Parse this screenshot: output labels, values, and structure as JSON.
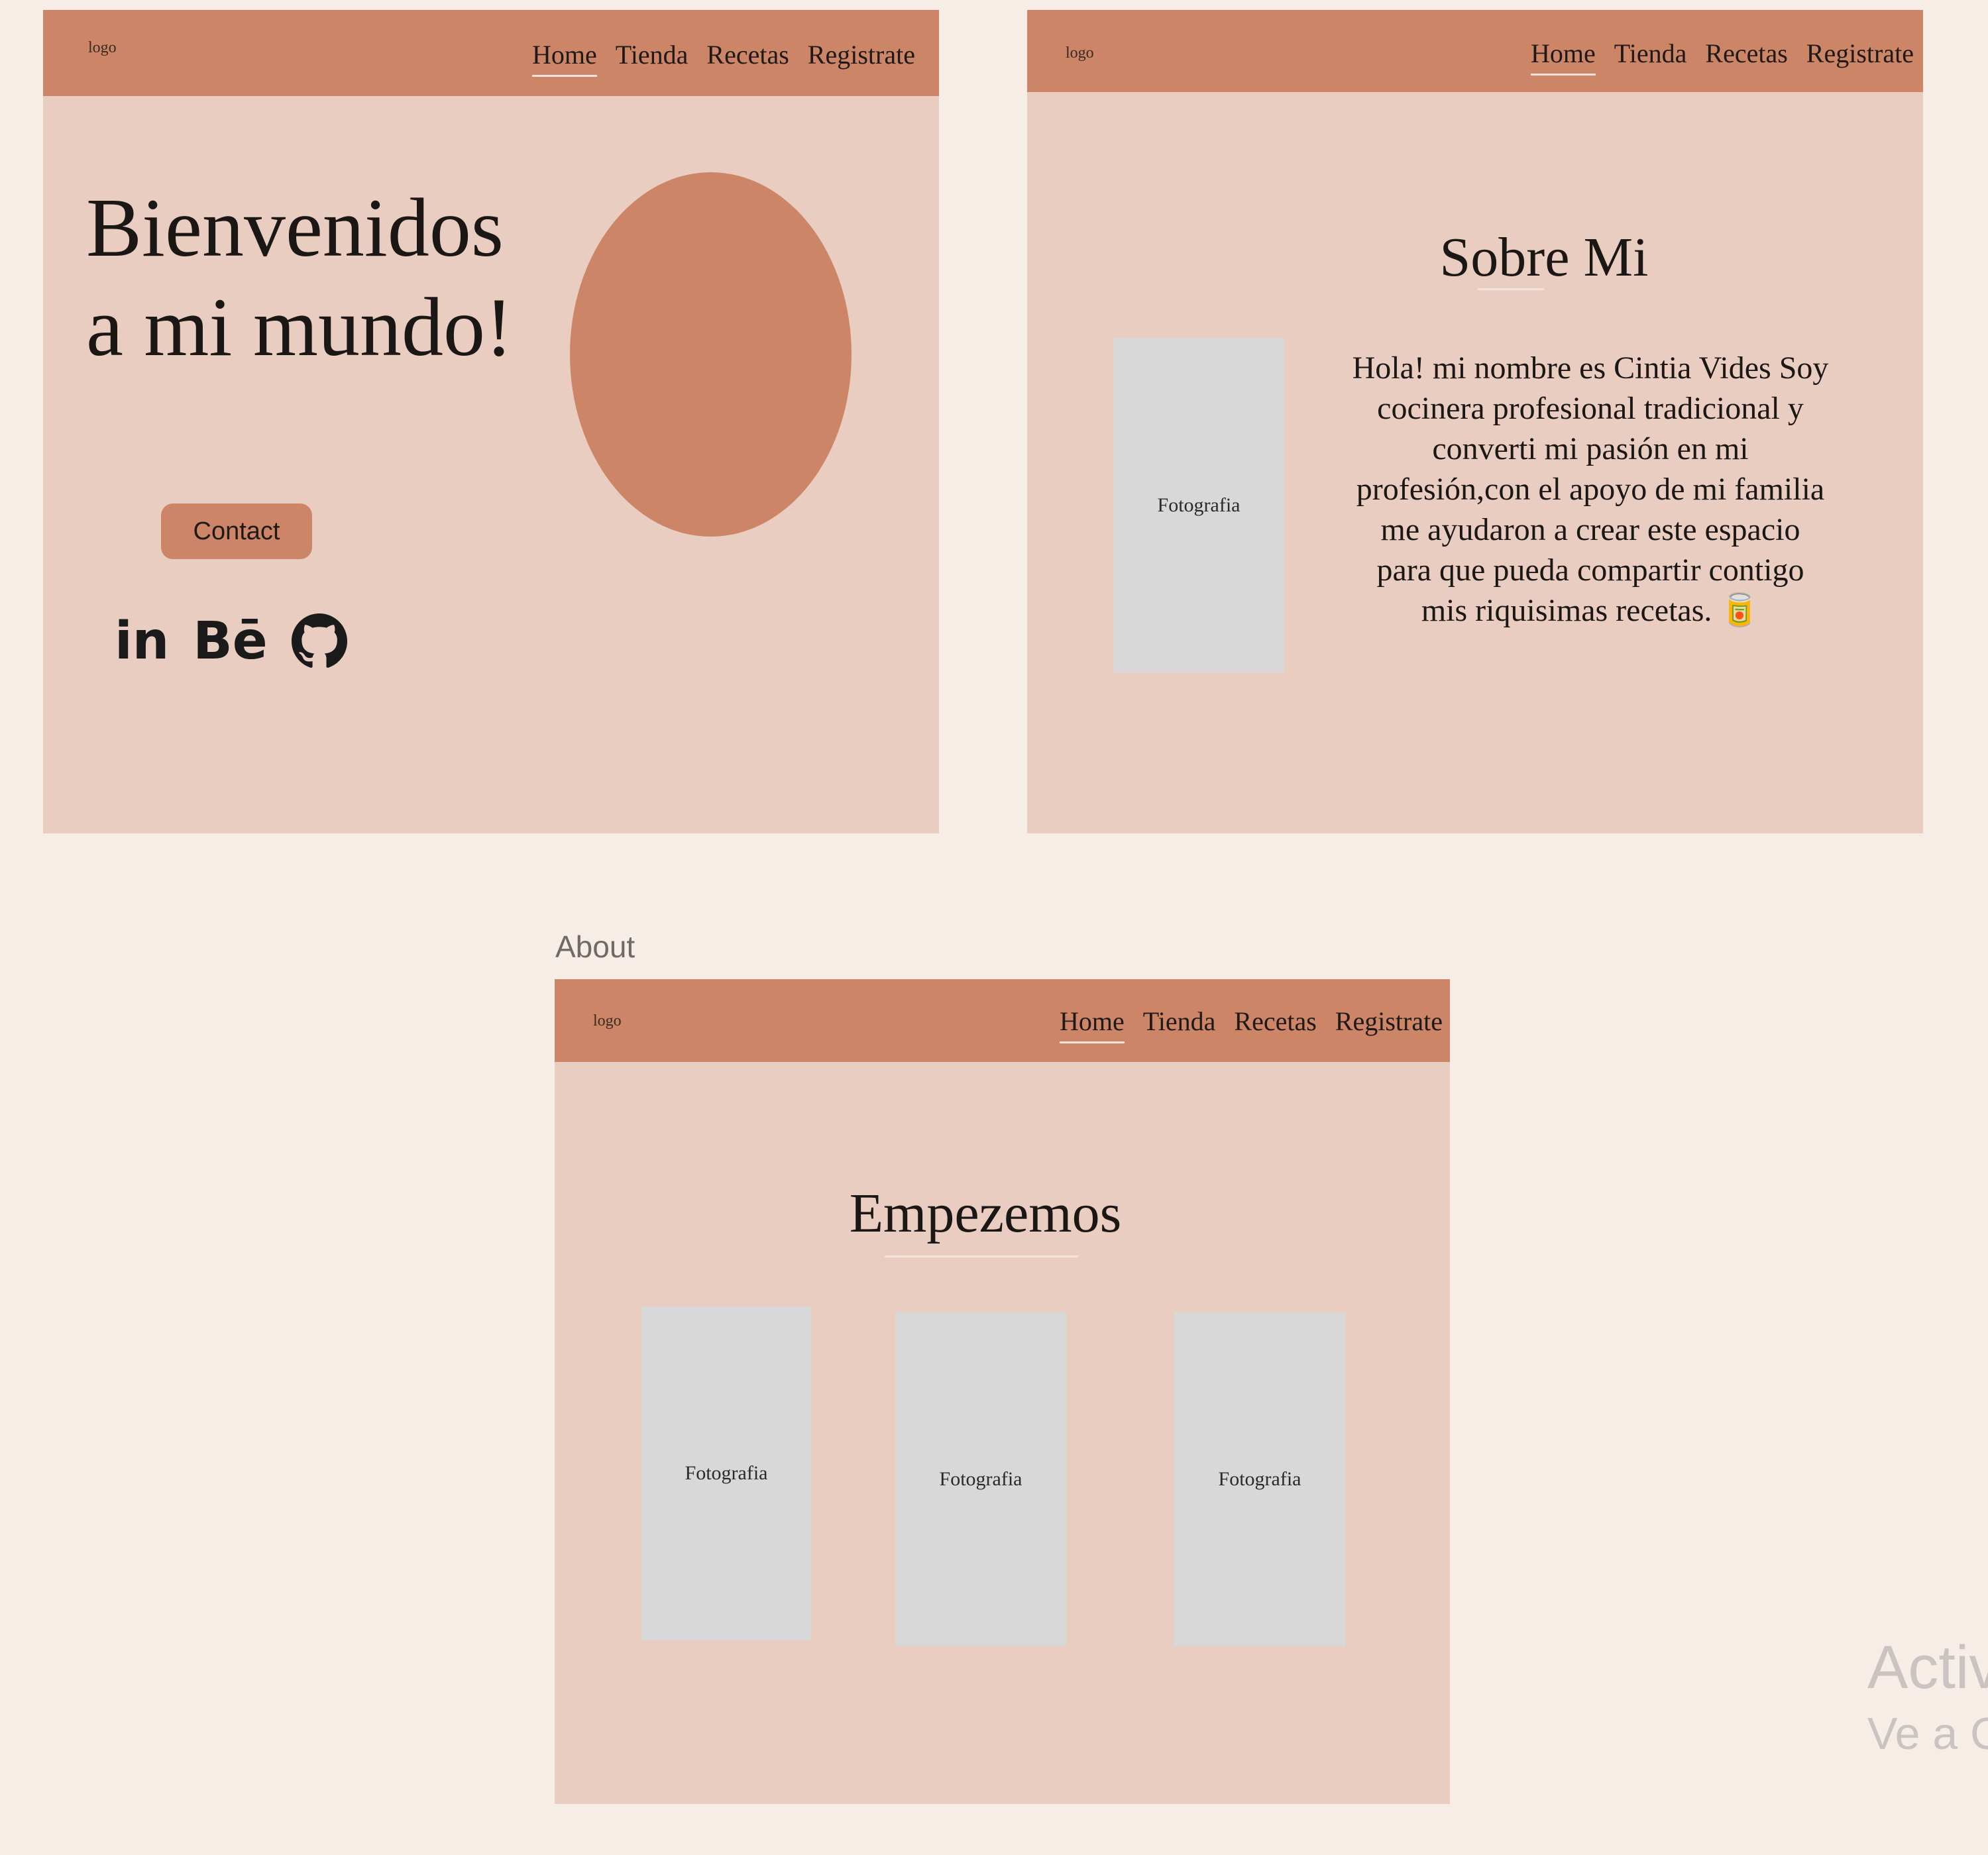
{
  "nav": {
    "logo": "logo",
    "links": [
      "Home",
      "Tienda",
      "Recetas",
      "Registrate"
    ]
  },
  "home": {
    "title_line1": "Bienvenidos",
    "title_line2": "a mi mundo!",
    "contact_label": "Contact",
    "socials": [
      "in",
      "Bē",
      "github-icon"
    ]
  },
  "about": {
    "title": "Sobre Mi",
    "photo_label": "Fotografia",
    "text": "Hola! mi nombre es Cintia Vides Soy cocinera profesional tradicional y converti mi pasión en mi profesión,con el apoyo de mi familia me ayudaron a crear este espacio para que pueda compartir contigo mis riquisimas recetas. 🥫"
  },
  "start": {
    "frame_label": "About",
    "title": "Empezemos",
    "photos": [
      "Fotografia",
      "Fotografia",
      "Fotografia"
    ]
  },
  "watermark": {
    "line1": "Activa",
    "line2": "Ve a Co"
  },
  "colors": {
    "page_bg": "#f5ede6",
    "frame_bg": "#e9cdc1",
    "accent": "#cd8567",
    "photo_placeholder": "#d8d8d8"
  }
}
